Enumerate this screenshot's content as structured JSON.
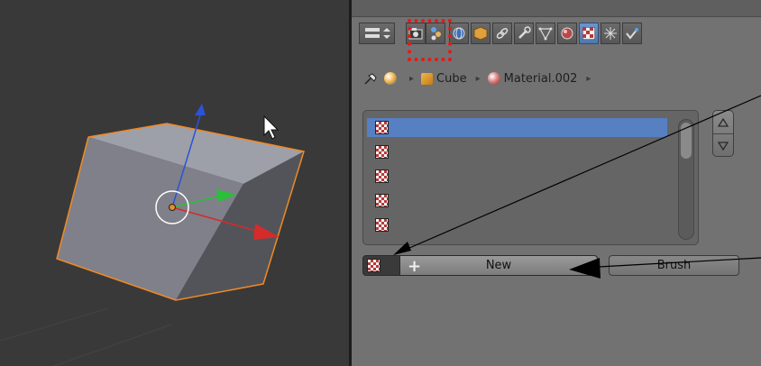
{
  "viewport": {
    "name": "3d-viewport",
    "colors": {
      "background": "#393939",
      "cube_top": "#9ea0a9",
      "cube_left": "#7f8089",
      "cube_right": "#53545a",
      "selection_outline": "#f08a24"
    }
  },
  "properties": {
    "toolbar": {
      "tabs": [
        {
          "icon": "editor-type-icon",
          "active": false
        },
        {
          "icon": "render-camera-icon",
          "active": false
        },
        {
          "icon": "render-layers-icon",
          "active": false
        },
        {
          "icon": "world-icon",
          "active": false
        },
        {
          "icon": "object-icon",
          "active": false
        },
        {
          "icon": "constraints-icon",
          "active": false
        },
        {
          "icon": "modifiers-wrench-icon",
          "active": false
        },
        {
          "icon": "object-data-icon",
          "active": false
        },
        {
          "icon": "material-icon",
          "active": false
        },
        {
          "icon": "texture-icon",
          "active": true
        },
        {
          "icon": "particles-icon",
          "active": false
        },
        {
          "icon": "physics-icon",
          "active": false
        }
      ]
    },
    "breadcrumb": {
      "items": [
        {
          "label": "",
          "icon": "pin-icon"
        },
        {
          "label": "",
          "icon": "object-context-icon"
        },
        {
          "label": "Cube",
          "icon": "cube-icon"
        },
        {
          "label": "Material.002",
          "icon": "material-sphere-icon"
        }
      ]
    },
    "texture_slots": {
      "count": 5,
      "selected_index": 0,
      "icon": "checker-texture-icon"
    },
    "texture_new_button": {
      "label": "New",
      "icon": "plus-icon"
    },
    "brush_button": {
      "label": "Brush"
    },
    "colors": {
      "panel_bg": "#727272",
      "selection": "#5680c2",
      "active_tab": "#5a82bd",
      "highlight_box": "#e21b1b"
    }
  }
}
